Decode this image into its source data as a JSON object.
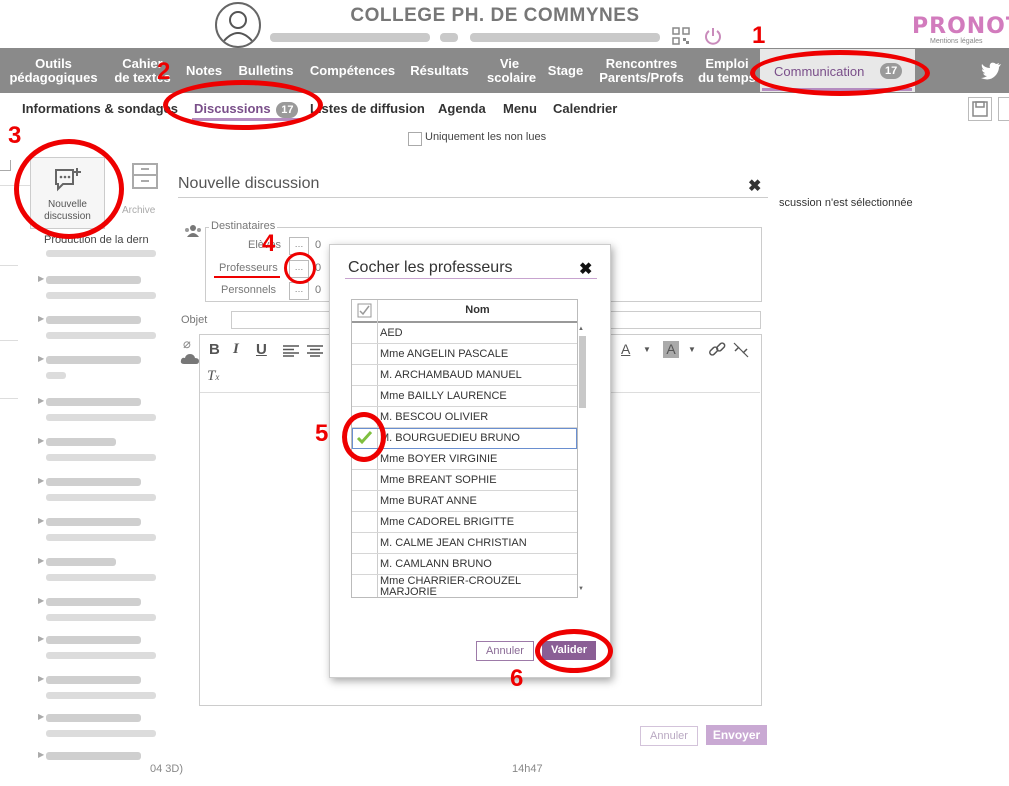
{
  "header": {
    "school_name": "COLLEGE PH. DE COMMYNES",
    "brand": "PRONOTE",
    "mentions": "Mentions légales"
  },
  "nav": {
    "items": [
      {
        "label": "Outils\npédagogiques"
      },
      {
        "label": "Cahier\nde textes"
      },
      {
        "label": "Notes"
      },
      {
        "label": "Bulletins"
      },
      {
        "label": "Compétences"
      },
      {
        "label": "Résultats"
      },
      {
        "label": "Vie\nscolaire"
      },
      {
        "label": "Stage"
      },
      {
        "label": "Rencontres\nParents/Profs"
      },
      {
        "label": "Emploi\ndu temps"
      }
    ],
    "active": {
      "label": "Communication",
      "badge": "17"
    }
  },
  "subnav": {
    "items": [
      "Informations & sondages",
      "Discussions",
      "Listes de diffusion",
      "Agenda",
      "Menu",
      "Calendrier"
    ],
    "discussions_badge": "17"
  },
  "filter": {
    "label": "Uniquement les non lues"
  },
  "left": {
    "new_discussion": "Nouvelle\ndiscussion",
    "archive": "Archive",
    "first_item": "Production de la dern"
  },
  "main": {
    "title": "Nouvelle discussion",
    "recipients_label": "Destinataires",
    "eleves": "Elèves",
    "professeurs": "Professeurs",
    "personnels": "Personnels",
    "counts": [
      "0",
      "0",
      "0"
    ],
    "objet": "Objet",
    "cancel": "Annuler",
    "send": "Envoyer",
    "right_message": "scussion n'est sélectionnée",
    "time": "14h47",
    "row_suffix": "04 3D)"
  },
  "modal": {
    "title": "Cocher les professeurs",
    "column": "Nom",
    "rows": [
      {
        "name": "AED",
        "checked": false
      },
      {
        "name": "Mme ANGELIN PASCALE",
        "checked": false
      },
      {
        "name": "M. ARCHAMBAUD MANUEL",
        "checked": false
      },
      {
        "name": "Mme BAILLY LAURENCE",
        "checked": false
      },
      {
        "name": "M. BESCOU OLIVIER",
        "checked": false
      },
      {
        "name": "M. BOURGUEDIEU BRUNO",
        "checked": true
      },
      {
        "name": "Mme BOYER VIRGINIE",
        "checked": false
      },
      {
        "name": "Mme BREANT SOPHIE",
        "checked": false
      },
      {
        "name": "Mme BURAT ANNE",
        "checked": false
      },
      {
        "name": "Mme CADOREL BRIGITTE",
        "checked": false
      },
      {
        "name": "M. CALME JEAN CHRISTIAN",
        "checked": false
      },
      {
        "name": "M. CAMLANN BRUNO",
        "checked": false
      },
      {
        "name": "Mme CHARRIER-CROUZEL\nMARJORIE",
        "checked": false
      }
    ],
    "cancel": "Annuler",
    "validate": "Valider"
  },
  "annotations": [
    "1",
    "2",
    "3",
    "4",
    "5",
    "6"
  ],
  "colors": {
    "accent": "#8a5e95",
    "annotation": "#e00000",
    "nav": "#8a8a8a"
  }
}
